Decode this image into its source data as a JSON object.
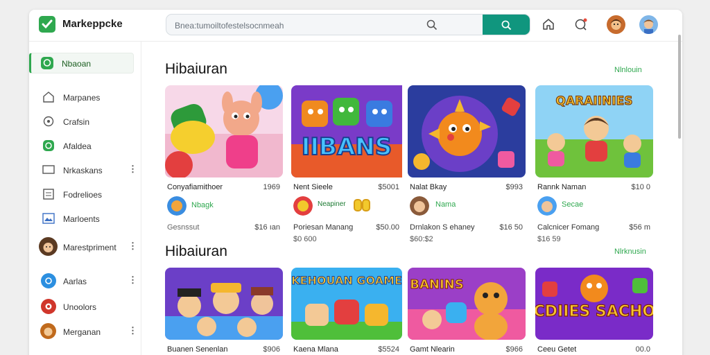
{
  "app": {
    "title": "Markeppcke"
  },
  "search": {
    "placeholder": "Bnea:tumoiltofestelsocnmeah"
  },
  "sidebar": {
    "active": {
      "label": "Nbaoan"
    },
    "items": [
      {
        "label": "Marpanes",
        "icon": "home-icon"
      },
      {
        "label": "Crafsin",
        "icon": "gear-icon"
      },
      {
        "label": "Afaldea",
        "icon": "chat-icon"
      },
      {
        "label": "Nrkaskans",
        "icon": "monitor-icon"
      },
      {
        "label": "Fodrelioes",
        "icon": "list-icon"
      },
      {
        "label": "Marloents",
        "icon": "image-icon"
      },
      {
        "label": "Marestpriment",
        "icon": "avatar"
      },
      {
        "label": "Aarlas",
        "icon": "info-icon"
      },
      {
        "label": "Unoolors",
        "icon": "badge-icon"
      },
      {
        "label": "Merganan",
        "icon": "avatar"
      }
    ]
  },
  "sections": [
    {
      "title": "Hibaiuran",
      "view_all": "Nlnlouin",
      "cards": [
        {
          "title": "Conyafiamithoer",
          "price": "1969",
          "sub_label": "Nbagk",
          "foot_left": "Gesnssut",
          "foot_right": "$16 ıan"
        },
        {
          "title": "Nent Sieele",
          "price": "$5001",
          "sub_label": "Neapiner",
          "foot_left": "Poriesan Manang",
          "foot_right": "$50.00",
          "foot_left_2": "$0 600"
        },
        {
          "title": "Nalat Bkay",
          "price": "$993",
          "sub_label": "Nama",
          "foot_left": "Drnlakon S ehaney",
          "foot_right": "$16 50",
          "foot_left_2": "$60:$2"
        },
        {
          "title": "Rannk Naman",
          "price": "$10 0",
          "sub_label": "Secae",
          "foot_left": "Calcnicer Fomang",
          "foot_right": "$56 m",
          "foot_left_2": "$16 59"
        }
      ],
      "thumb_texts": [
        "",
        "IIBANS",
        "",
        "QARAIINIES"
      ]
    },
    {
      "title": "Hibaiuran",
      "view_all": "Nlrknusin",
      "cards": [
        {
          "title": "Buanen Senenlan",
          "price": "$906"
        },
        {
          "title": "Kaena Mlana",
          "price": "$5524"
        },
        {
          "title": "Gamt Nlearin",
          "price": "$966"
        },
        {
          "title": "Ceeu Getet",
          "price": "00.0"
        }
      ],
      "thumb_texts": [
        "",
        "KEHOUAN GOAME",
        "BANINS",
        "KACDIIES SACHOIAI"
      ]
    }
  ],
  "colors": {
    "brand_green": "#2fa84f",
    "search_button": "#10967e"
  }
}
